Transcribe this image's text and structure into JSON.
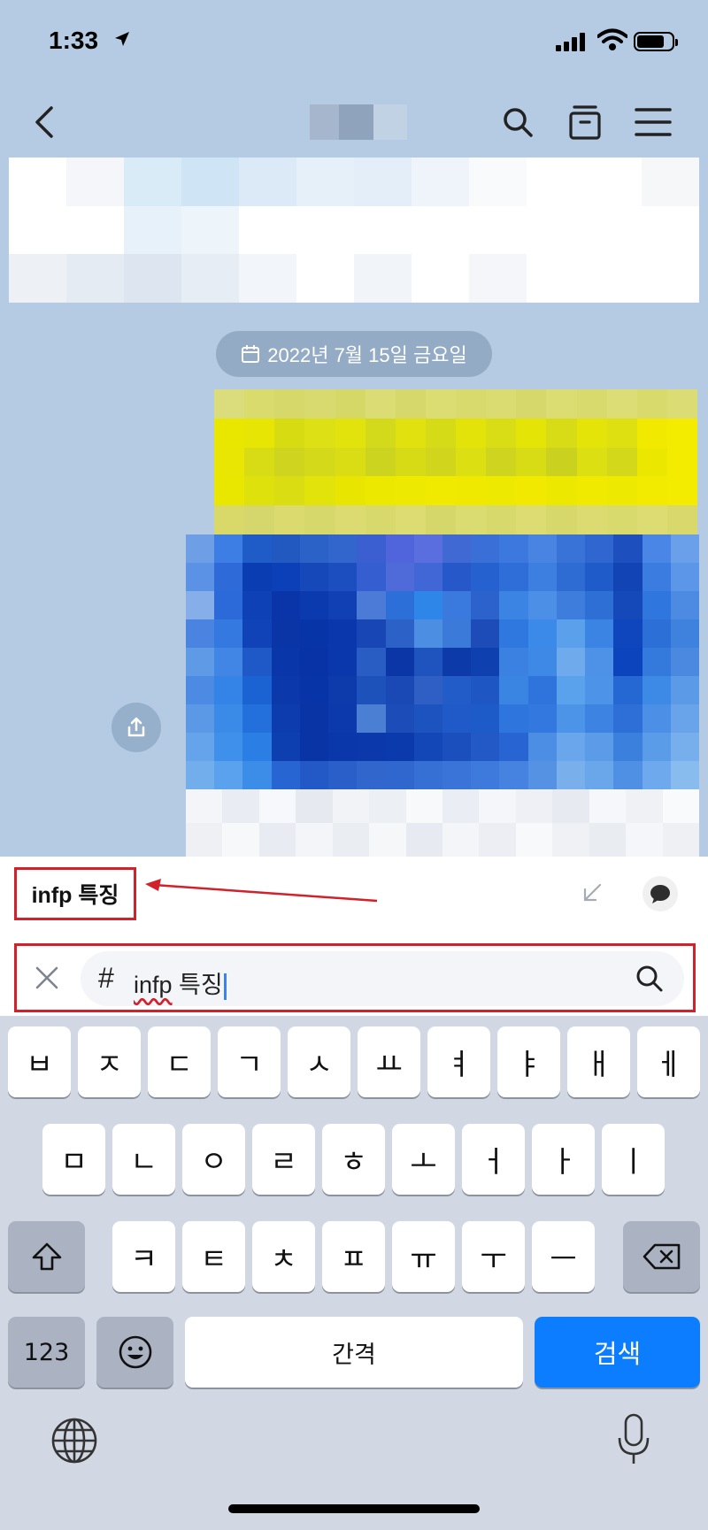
{
  "status_bar": {
    "time": "1:33"
  },
  "chat": {
    "date_label": "2022년 7월 15일 금요일"
  },
  "search": {
    "result_term": "infp 특징",
    "hash_symbol": "#",
    "query_underlined": "infp",
    "query_rest": " 특징"
  },
  "keyboard": {
    "row1": [
      "ㅂ",
      "ㅈ",
      "ㄷ",
      "ㄱ",
      "ㅅ",
      "ㅛ",
      "ㅕ",
      "ㅑ",
      "ㅐ",
      "ㅔ"
    ],
    "row2": [
      "ㅁ",
      "ㄴ",
      "ㅇ",
      "ㄹ",
      "ㅎ",
      "ㅗ",
      "ㅓ",
      "ㅏ",
      "ㅣ"
    ],
    "row3": [
      "ㅋ",
      "ㅌ",
      "ㅊ",
      "ㅍ",
      "ㅠ",
      "ㅜ",
      "ㅡ"
    ],
    "numbers_label": "123",
    "space_label": "간격",
    "search_label": "검색"
  },
  "colors": {
    "chat_background": "#b5cae3",
    "highlight_red": "#d2212b",
    "keyboard_background": "#d2d8e3",
    "search_key_blue": "#0c7dff"
  }
}
